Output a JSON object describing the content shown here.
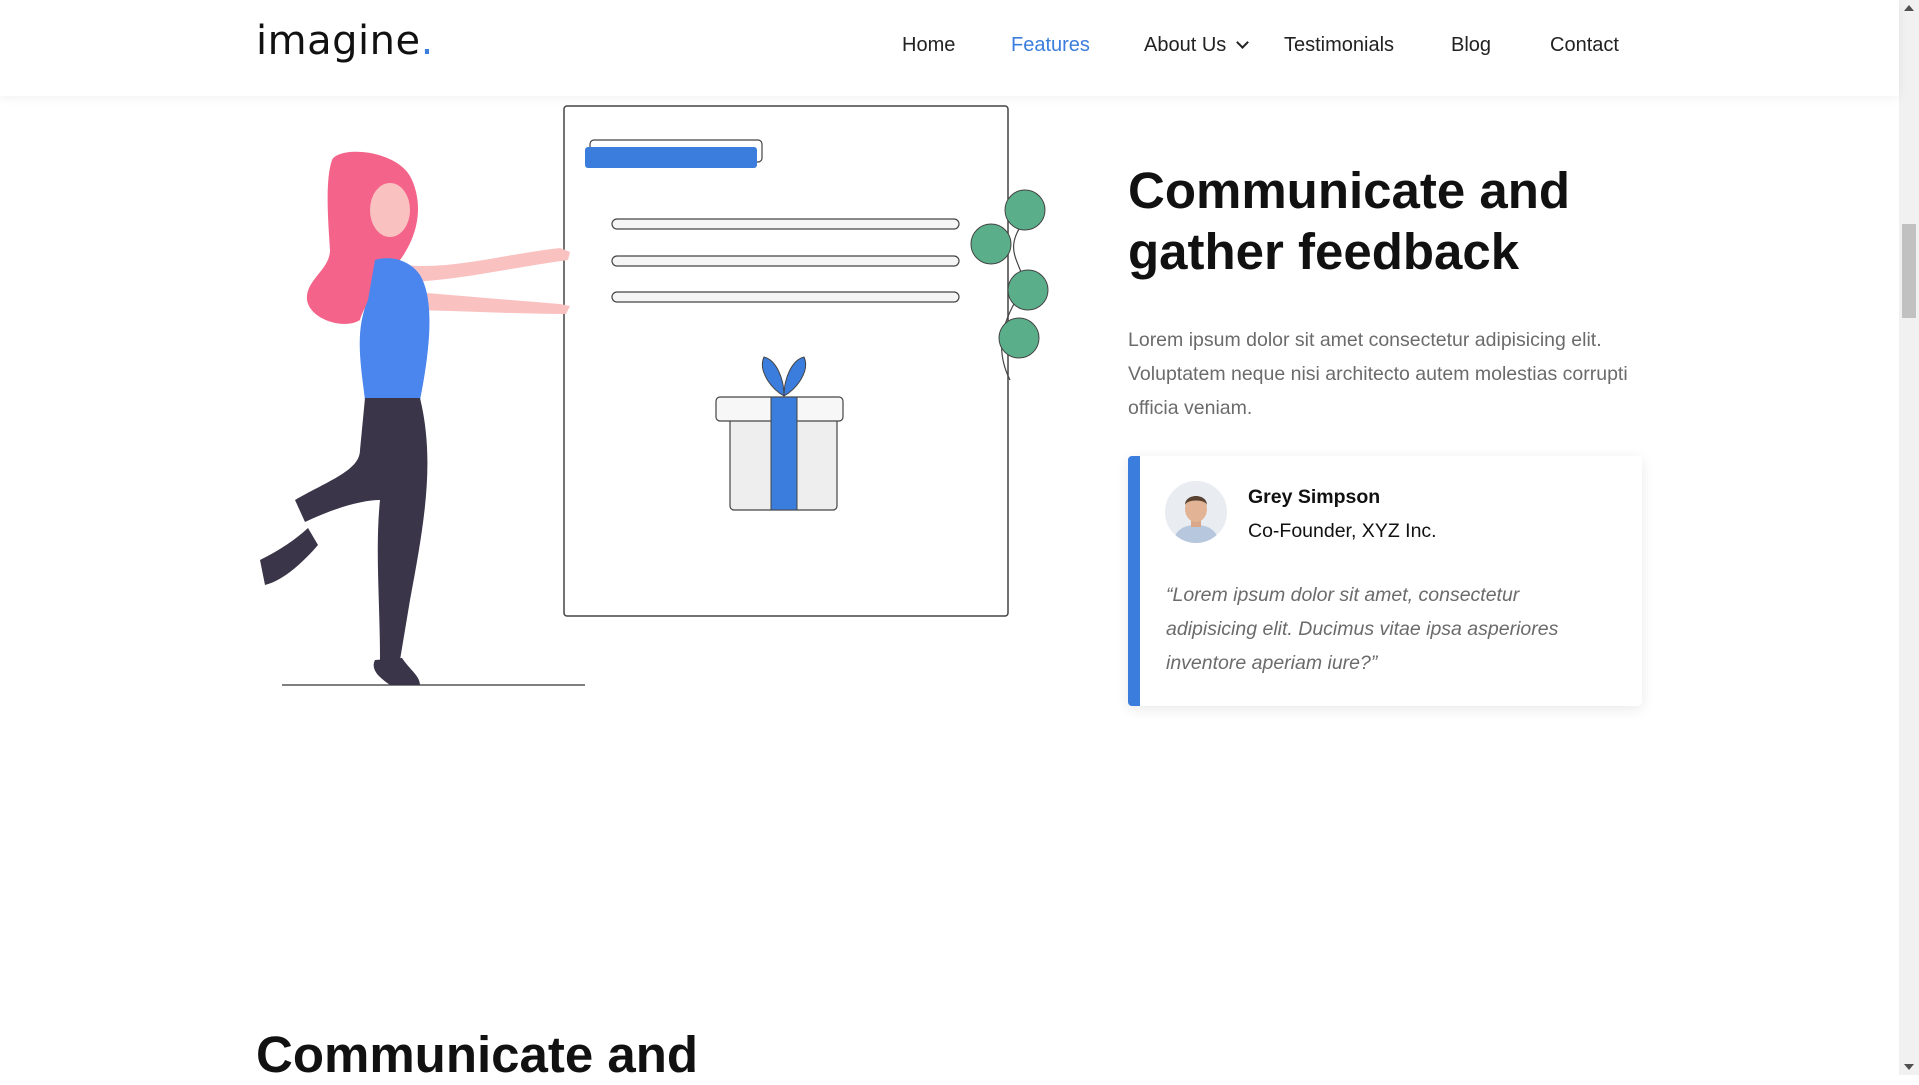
{
  "header": {
    "logo_text": "imagine",
    "logo_dot": ".",
    "nav": [
      {
        "label": "Home",
        "active": false
      },
      {
        "label": "Features",
        "active": true
      },
      {
        "label": "About Us",
        "active": false,
        "dropdown": true
      },
      {
        "label": "Testimonials",
        "active": false
      },
      {
        "label": "Blog",
        "active": false
      },
      {
        "label": "Contact",
        "active": false
      }
    ]
  },
  "feature": {
    "title_line1": "Communicate and",
    "title_line2": "gather feedback",
    "description": "Lorem ipsum dolor sit amet consectetur adipisicing elit. Voluptatem neque nisi architecto autem molestias corrupti officia veniam."
  },
  "testimonial": {
    "name": "Grey Simpson",
    "role": "Co-Founder, XYZ Inc.",
    "quote": "“Lorem ipsum dolor sit amet, consectetur adipisicing elit. Ducimus vitae ipsa asperiores inventore aperiam iure?”"
  },
  "next_section": {
    "title_line1": "Communicate and"
  },
  "colors": {
    "accent": "#3b7ddd",
    "hair": "#f4648a",
    "leaves": "#5aaf8a",
    "pants": "#3a3548"
  }
}
